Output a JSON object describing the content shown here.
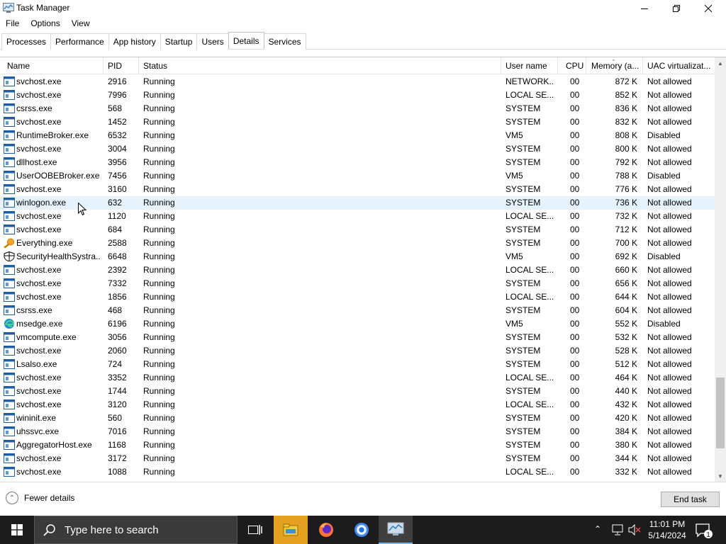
{
  "window": {
    "title": "Task Manager"
  },
  "menu": [
    "File",
    "Options",
    "View"
  ],
  "tabs": [
    {
      "label": "Processes"
    },
    {
      "label": "Performance"
    },
    {
      "label": "App history"
    },
    {
      "label": "Startup"
    },
    {
      "label": "Users"
    },
    {
      "label": "Details",
      "active": true
    },
    {
      "label": "Services"
    }
  ],
  "columns": {
    "name": "Name",
    "pid": "PID",
    "status": "Status",
    "user": "User name",
    "cpu": "CPU",
    "memory": "Memory (a...",
    "uac": "UAC virtualizat..."
  },
  "rows": [
    {
      "icon": "window-app-icon",
      "name": "svchost.exe",
      "pid": "2916",
      "status": "Running",
      "user": "NETWORK...",
      "cpu": "00",
      "mem": "872 K",
      "uac": "Not allowed"
    },
    {
      "icon": "window-app-icon",
      "name": "svchost.exe",
      "pid": "7996",
      "status": "Running",
      "user": "LOCAL SE...",
      "cpu": "00",
      "mem": "852 K",
      "uac": "Not allowed"
    },
    {
      "icon": "window-app-icon",
      "name": "csrss.exe",
      "pid": "568",
      "status": "Running",
      "user": "SYSTEM",
      "cpu": "00",
      "mem": "836 K",
      "uac": "Not allowed"
    },
    {
      "icon": "window-app-icon",
      "name": "svchost.exe",
      "pid": "1452",
      "status": "Running",
      "user": "SYSTEM",
      "cpu": "00",
      "mem": "832 K",
      "uac": "Not allowed"
    },
    {
      "icon": "window-app-icon",
      "name": "RuntimeBroker.exe",
      "pid": "6532",
      "status": "Running",
      "user": "VM5",
      "cpu": "00",
      "mem": "808 K",
      "uac": "Disabled"
    },
    {
      "icon": "window-app-icon",
      "name": "svchost.exe",
      "pid": "3004",
      "status": "Running",
      "user": "SYSTEM",
      "cpu": "00",
      "mem": "800 K",
      "uac": "Not allowed"
    },
    {
      "icon": "window-app-icon",
      "name": "dllhost.exe",
      "pid": "3956",
      "status": "Running",
      "user": "SYSTEM",
      "cpu": "00",
      "mem": "792 K",
      "uac": "Not allowed"
    },
    {
      "icon": "window-app-icon",
      "name": "UserOOBEBroker.exe",
      "pid": "7456",
      "status": "Running",
      "user": "VM5",
      "cpu": "00",
      "mem": "788 K",
      "uac": "Disabled"
    },
    {
      "icon": "window-app-icon",
      "name": "svchost.exe",
      "pid": "3160",
      "status": "Running",
      "user": "SYSTEM",
      "cpu": "00",
      "mem": "776 K",
      "uac": "Not allowed"
    },
    {
      "icon": "window-app-icon",
      "name": "winlogon.exe",
      "pid": "632",
      "status": "Running",
      "user": "SYSTEM",
      "cpu": "00",
      "mem": "736 K",
      "uac": "Not allowed",
      "hover": true
    },
    {
      "icon": "window-app-icon",
      "name": "svchost.exe",
      "pid": "1120",
      "status": "Running",
      "user": "LOCAL SE...",
      "cpu": "00",
      "mem": "732 K",
      "uac": "Not allowed"
    },
    {
      "icon": "window-app-icon",
      "name": "svchost.exe",
      "pid": "684",
      "status": "Running",
      "user": "SYSTEM",
      "cpu": "00",
      "mem": "712 K",
      "uac": "Not allowed"
    },
    {
      "icon": "magnifier-app-icon",
      "name": "Everything.exe",
      "pid": "2588",
      "status": "Running",
      "user": "SYSTEM",
      "cpu": "00",
      "mem": "700 K",
      "uac": "Not allowed"
    },
    {
      "icon": "shield-app-icon",
      "name": "SecurityHealthSystra...",
      "pid": "6648",
      "status": "Running",
      "user": "VM5",
      "cpu": "00",
      "mem": "692 K",
      "uac": "Disabled"
    },
    {
      "icon": "window-app-icon",
      "name": "svchost.exe",
      "pid": "2392",
      "status": "Running",
      "user": "LOCAL SE...",
      "cpu": "00",
      "mem": "660 K",
      "uac": "Not allowed"
    },
    {
      "icon": "window-app-icon",
      "name": "svchost.exe",
      "pid": "7332",
      "status": "Running",
      "user": "SYSTEM",
      "cpu": "00",
      "mem": "656 K",
      "uac": "Not allowed"
    },
    {
      "icon": "window-app-icon",
      "name": "svchost.exe",
      "pid": "1856",
      "status": "Running",
      "user": "LOCAL SE...",
      "cpu": "00",
      "mem": "644 K",
      "uac": "Not allowed"
    },
    {
      "icon": "window-app-icon",
      "name": "csrss.exe",
      "pid": "468",
      "status": "Running",
      "user": "SYSTEM",
      "cpu": "00",
      "mem": "604 K",
      "uac": "Not allowed"
    },
    {
      "icon": "edge-app-icon",
      "name": "msedge.exe",
      "pid": "6196",
      "status": "Running",
      "user": "VM5",
      "cpu": "00",
      "mem": "552 K",
      "uac": "Disabled"
    },
    {
      "icon": "window-app-icon",
      "name": "vmcompute.exe",
      "pid": "3056",
      "status": "Running",
      "user": "SYSTEM",
      "cpu": "00",
      "mem": "532 K",
      "uac": "Not allowed"
    },
    {
      "icon": "window-app-icon",
      "name": "svchost.exe",
      "pid": "2060",
      "status": "Running",
      "user": "SYSTEM",
      "cpu": "00",
      "mem": "528 K",
      "uac": "Not allowed"
    },
    {
      "icon": "window-app-icon",
      "name": "Lsalso.exe",
      "pid": "724",
      "status": "Running",
      "user": "SYSTEM",
      "cpu": "00",
      "mem": "512 K",
      "uac": "Not allowed"
    },
    {
      "icon": "window-app-icon",
      "name": "svchost.exe",
      "pid": "3352",
      "status": "Running",
      "user": "LOCAL SE...",
      "cpu": "00",
      "mem": "464 K",
      "uac": "Not allowed"
    },
    {
      "icon": "window-app-icon",
      "name": "svchost.exe",
      "pid": "1744",
      "status": "Running",
      "user": "SYSTEM",
      "cpu": "00",
      "mem": "440 K",
      "uac": "Not allowed"
    },
    {
      "icon": "window-app-icon",
      "name": "svchost.exe",
      "pid": "3120",
      "status": "Running",
      "user": "LOCAL SE...",
      "cpu": "00",
      "mem": "432 K",
      "uac": "Not allowed"
    },
    {
      "icon": "window-app-icon",
      "name": "wininit.exe",
      "pid": "560",
      "status": "Running",
      "user": "SYSTEM",
      "cpu": "00",
      "mem": "420 K",
      "uac": "Not allowed"
    },
    {
      "icon": "window-app-icon",
      "name": "uhssvc.exe",
      "pid": "7016",
      "status": "Running",
      "user": "SYSTEM",
      "cpu": "00",
      "mem": "384 K",
      "uac": "Not allowed"
    },
    {
      "icon": "window-app-icon",
      "name": "AggregatorHost.exe",
      "pid": "1168",
      "status": "Running",
      "user": "SYSTEM",
      "cpu": "00",
      "mem": "380 K",
      "uac": "Not allowed"
    },
    {
      "icon": "window-app-icon",
      "name": "svchost.exe",
      "pid": "3172",
      "status": "Running",
      "user": "SYSTEM",
      "cpu": "00",
      "mem": "344 K",
      "uac": "Not allowed"
    },
    {
      "icon": "window-app-icon",
      "name": "svchost.exe",
      "pid": "1088",
      "status": "Running",
      "user": "LOCAL SE...",
      "cpu": "00",
      "mem": "332 K",
      "uac": "Not allowed"
    }
  ],
  "footer": {
    "fewer_details": "Fewer details",
    "end_task": "End task"
  },
  "taskbar": {
    "search_placeholder": "Type here to search",
    "time": "11:01 PM",
    "date": "5/14/2024",
    "notification_count": "1",
    "pinned": [
      "task-view-icon",
      "file-explorer-icon",
      "firefox-icon",
      "chrome-icon",
      "task-manager-icon"
    ]
  }
}
